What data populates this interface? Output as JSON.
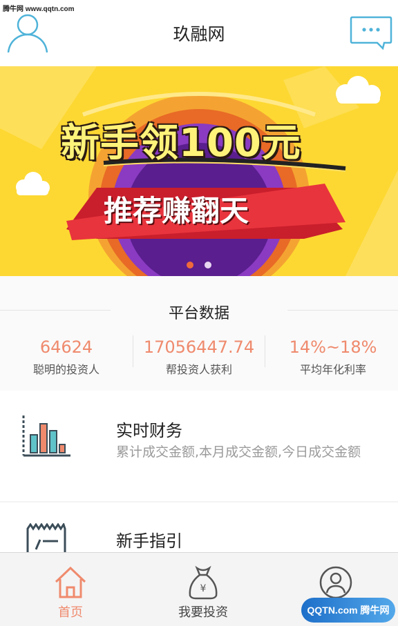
{
  "watermark_top": "腾牛网 www.qqtn.com",
  "header": {
    "title": "玖融网",
    "left_icon": "avatar-icon",
    "right_icon": "message-icon"
  },
  "banner": {
    "line1": "新手领100元",
    "line2": "推荐赚翻天",
    "active_dot": 1,
    "dot_count": 2
  },
  "stats": {
    "title": "平台数据",
    "items": [
      {
        "value": "64624",
        "label": "聪明的投资人"
      },
      {
        "value": "17056447.74",
        "label": "帮投资人获利"
      },
      {
        "value": "14%~18%",
        "label": "平均年化利率"
      }
    ]
  },
  "cards": [
    {
      "title": "实时财务",
      "desc": "累计成交金额,本月成交金额,今日成交金额",
      "icon": "bar-chart-icon"
    },
    {
      "title": "新手指引",
      "desc": "",
      "icon": "guide-doc-icon"
    }
  ],
  "tabs": [
    {
      "label": "首页",
      "icon": "home-icon",
      "active": true
    },
    {
      "label": "我要投资",
      "icon": "money-bag-icon",
      "active": false
    },
    {
      "label": "我的账户",
      "icon": "user-circle-icon",
      "active": false
    }
  ],
  "watermark_bottom": "QQTN.com 腾牛网",
  "colors": {
    "accent": "#ef8a6d",
    "icon_blue": "#4fb3d9",
    "banner_yellow": "#fdd832",
    "tab_active": "#ef8a6d",
    "tab_inactive": "#444444"
  }
}
